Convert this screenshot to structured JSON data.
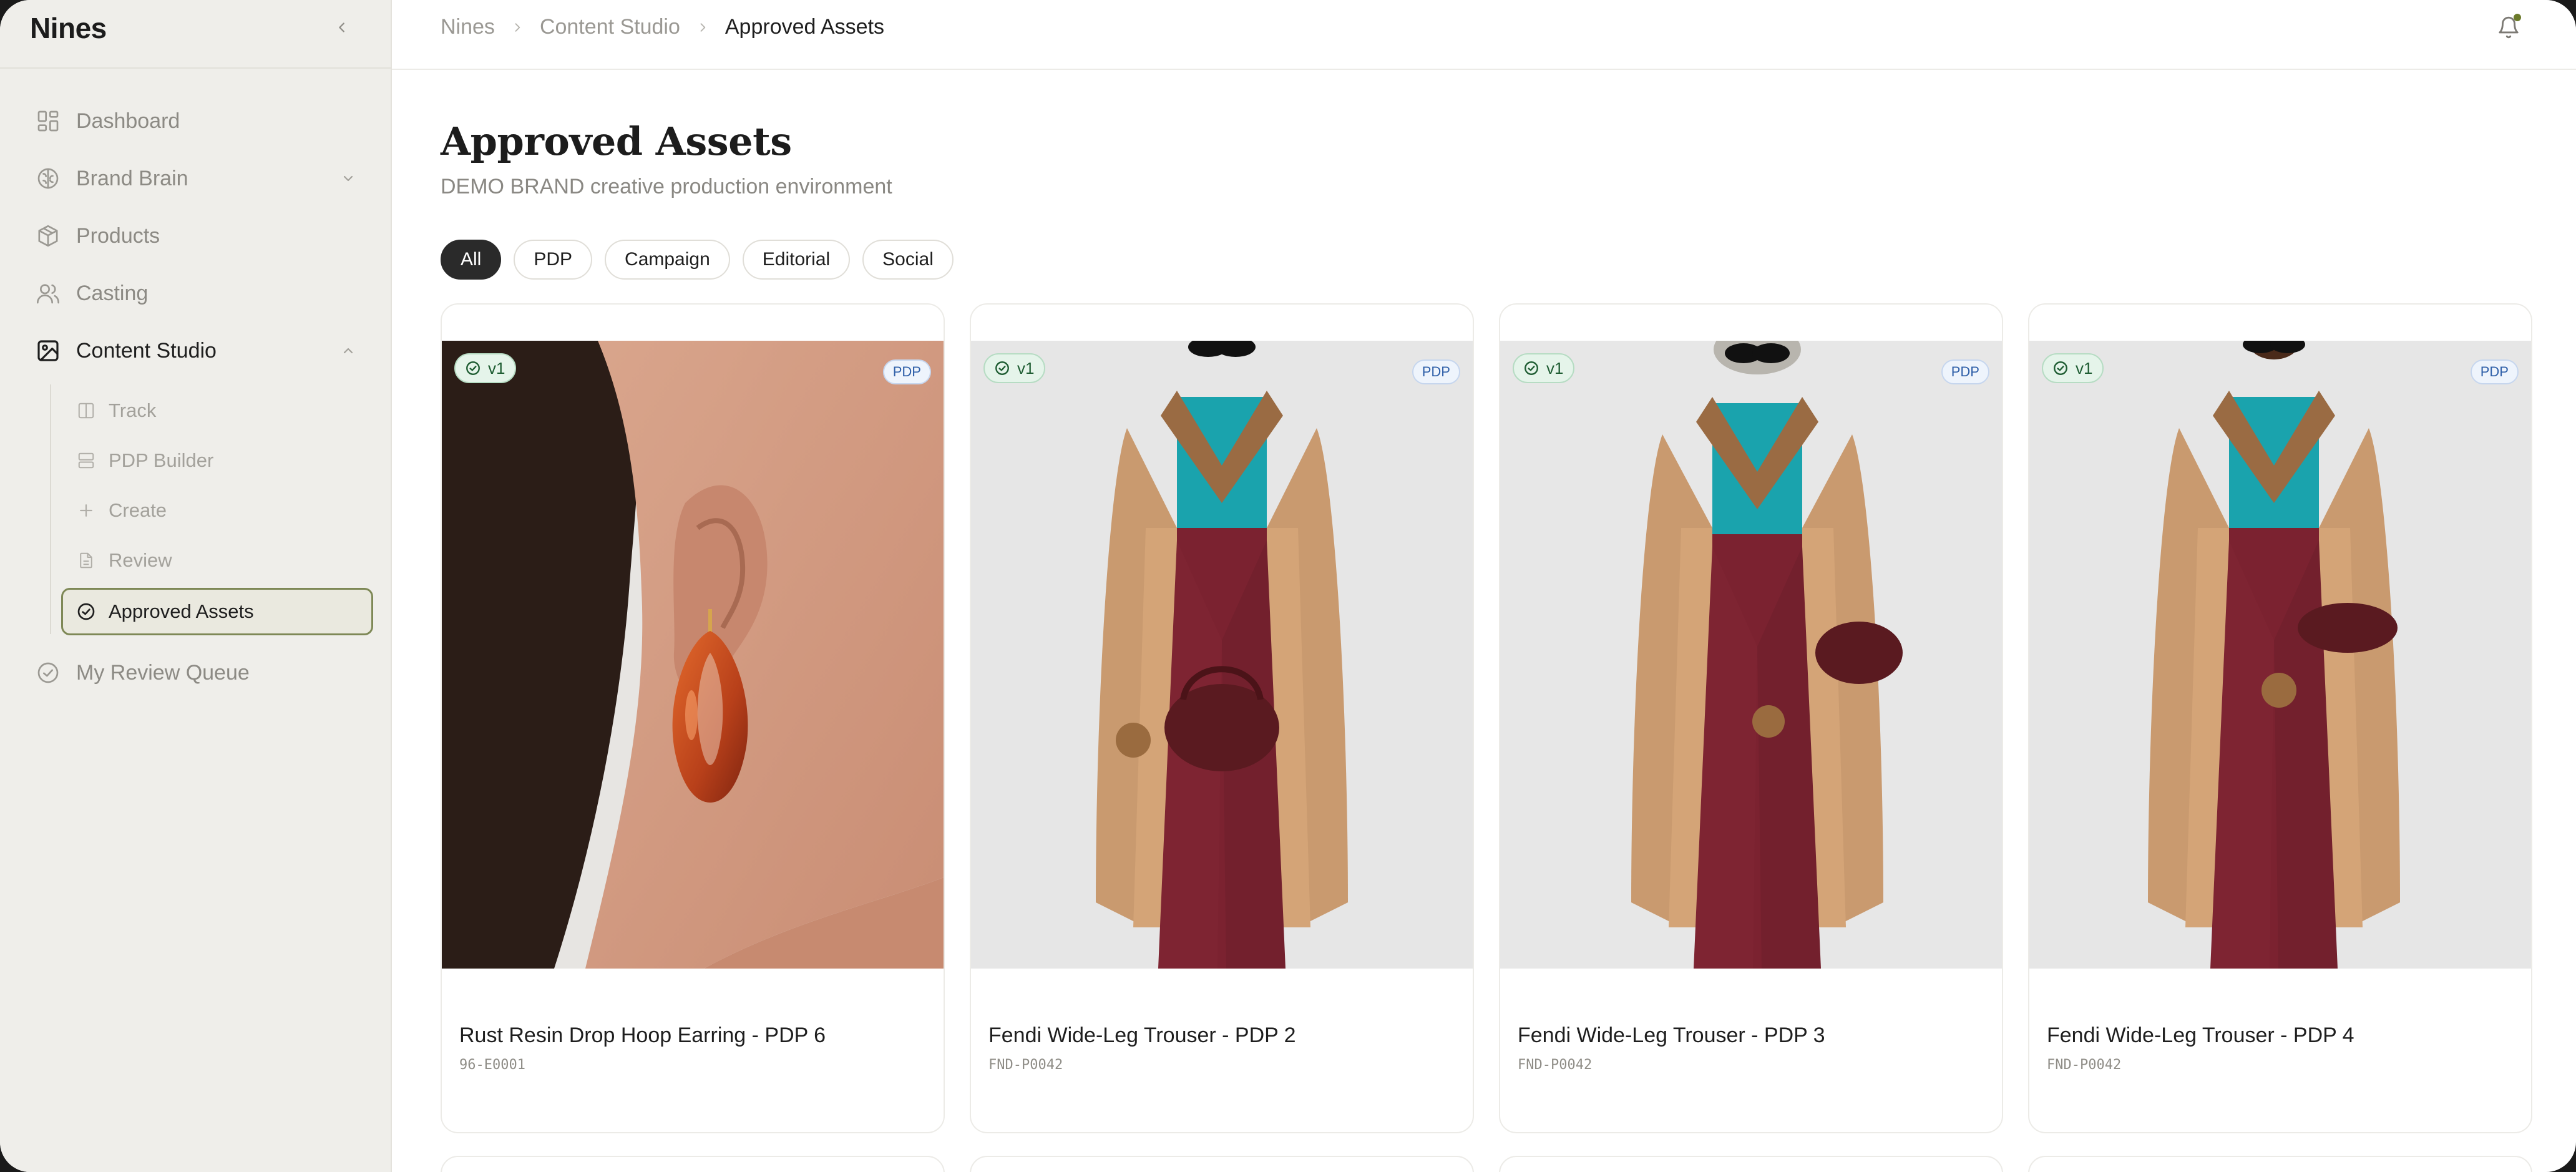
{
  "app": {
    "logo": "Nines"
  },
  "sidebar": {
    "items": [
      {
        "label": "Dashboard",
        "icon": "dashboard-icon"
      },
      {
        "label": "Brand Brain",
        "icon": "brain-icon"
      },
      {
        "label": "Products",
        "icon": "box-icon"
      },
      {
        "label": "Casting",
        "icon": "users-icon"
      },
      {
        "label": "Content Studio",
        "icon": "image-icon"
      },
      {
        "label": "My Review Queue",
        "icon": "check-circle-icon"
      }
    ],
    "content_studio_sub": [
      {
        "label": "Track",
        "icon": "columns-icon"
      },
      {
        "label": "PDP Builder",
        "icon": "layout-icon"
      },
      {
        "label": "Create",
        "icon": "plus-icon"
      },
      {
        "label": "Review",
        "icon": "file-icon"
      },
      {
        "label": "Approved Assets",
        "icon": "check-circle-icon",
        "active": true
      }
    ]
  },
  "breadcrumb": {
    "items": [
      "Nines",
      "Content Studio"
    ],
    "current": "Approved Assets"
  },
  "page": {
    "title": "Approved Assets",
    "subtitle": "DEMO BRAND creative production environment"
  },
  "filters": {
    "options": [
      "All",
      "PDP",
      "Campaign",
      "Editorial",
      "Social"
    ],
    "selected": "All"
  },
  "assets": [
    {
      "title": "Rust Resin Drop Hoop Earring - PDP 6",
      "sku": "96-E0001",
      "version": "v1",
      "type": "PDP"
    },
    {
      "title": "Fendi Wide-Leg Trouser - PDP 2",
      "sku": "FND-P0042",
      "version": "v1",
      "type": "PDP"
    },
    {
      "title": "Fendi Wide-Leg Trouser - PDP 3",
      "sku": "FND-P0042",
      "version": "v1",
      "type": "PDP"
    },
    {
      "title": "Fendi Wide-Leg Trouser - PDP 4",
      "sku": "FND-P0042",
      "version": "v1",
      "type": "PDP"
    }
  ],
  "colors": {
    "sidebar_bg": "#efeeea",
    "accent_active_border": "#7e8856",
    "chip_active": "#2a2a2a",
    "version_badge_bg": "#e5f4ea",
    "type_badge_bg": "#eef4fc",
    "notification_dot": "#6b7a2a"
  }
}
